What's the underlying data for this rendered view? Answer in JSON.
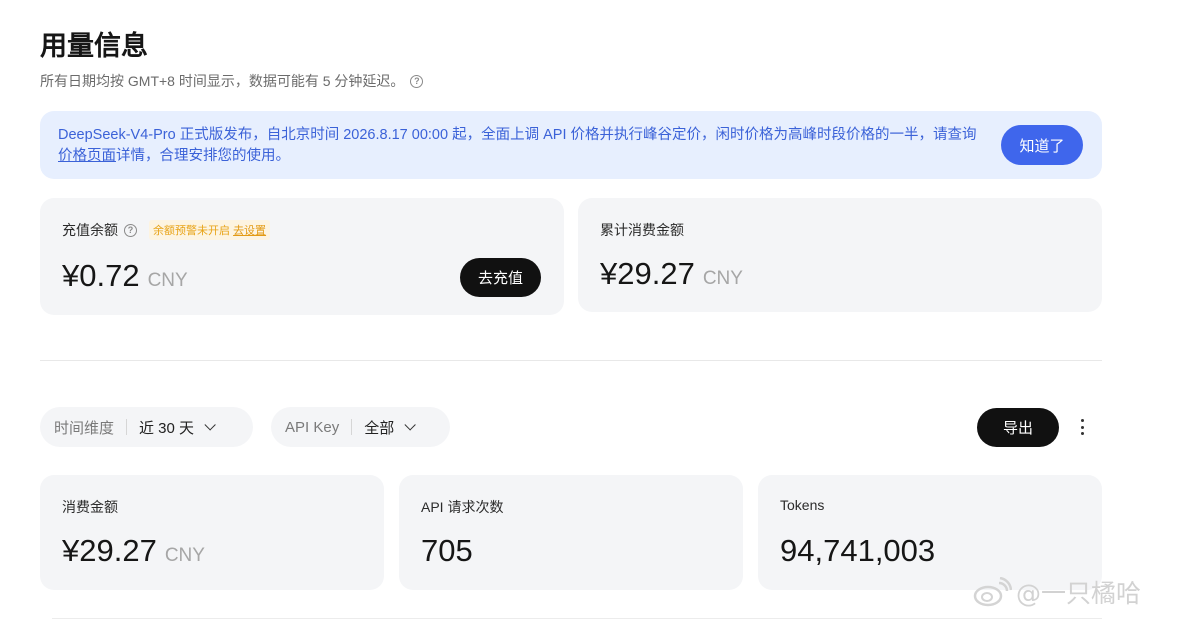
{
  "header": {
    "title": "用量信息",
    "subtitle": "所有日期均按 GMT+8 时间显示，数据可能有 5 分钟延迟。"
  },
  "banner": {
    "text_before": "DeepSeek-V4-Pro 正式版发布，自北京时间 2026.8.17 00:00 起，全面上调 API 价格并执行峰谷定价，闲时价格为高峰时段价格的一半，请查询",
    "link": "价格页面",
    "text_after": "详情，合理安排您的使用。",
    "button": "知道了"
  },
  "balance": {
    "label": "充值余额",
    "warning": "余额预警未开启",
    "warning_link": "去设置",
    "value": "¥0.72",
    "unit": "CNY",
    "button": "去充值"
  },
  "total_spend": {
    "label": "累计消费金额",
    "value": "¥29.27",
    "unit": "CNY"
  },
  "filters": {
    "time_label": "时间维度",
    "time_value": "近 30 天",
    "key_label": "API Key",
    "key_value": "全部",
    "export": "导出"
  },
  "stats": [
    {
      "label": "消费金额",
      "value": "¥29.27",
      "unit": "CNY"
    },
    {
      "label": "API 请求次数",
      "value": "705",
      "unit": ""
    },
    {
      "label": "Tokens",
      "value": "94,741,003",
      "unit": ""
    }
  ],
  "watermark": "@一只橘哈",
  "colors": {
    "accent": "#3f66ec",
    "banner_bg": "#e7effe",
    "card_bg": "#f4f5f7",
    "warning": "#e8a317"
  }
}
